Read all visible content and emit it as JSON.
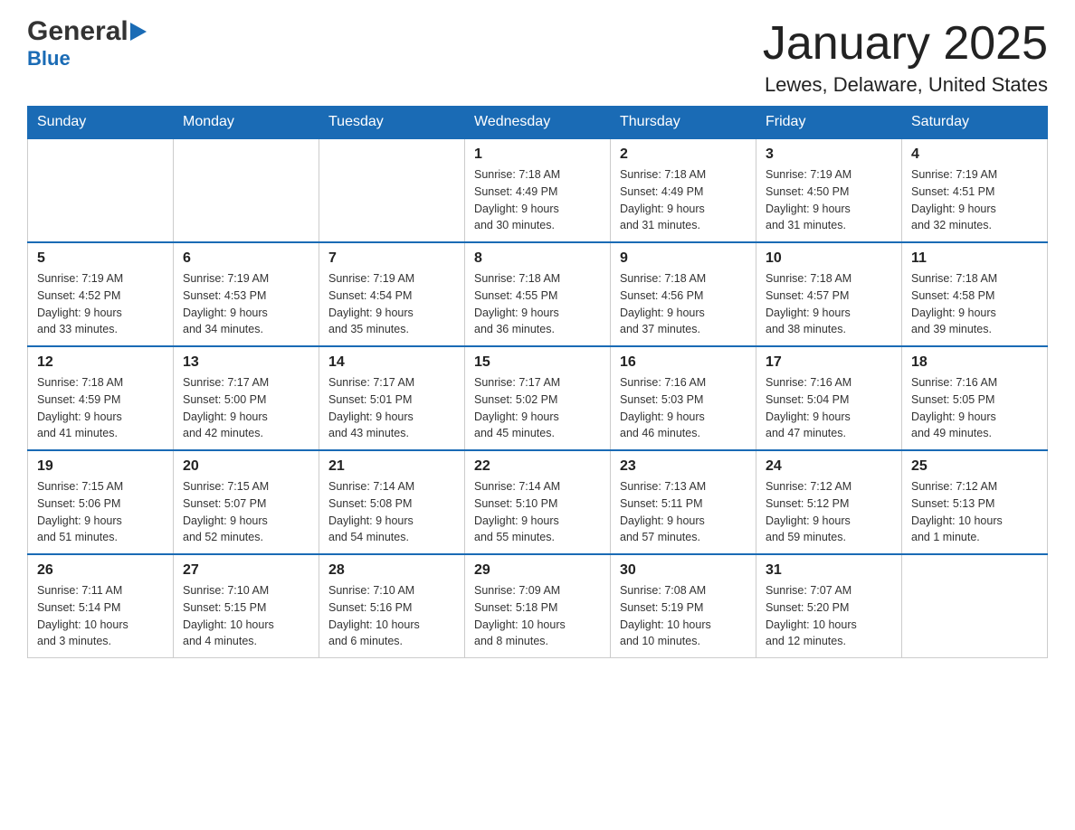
{
  "header": {
    "logo_general": "General",
    "logo_blue": "Blue",
    "title": "January 2025",
    "subtitle": "Lewes, Delaware, United States"
  },
  "calendar": {
    "days_of_week": [
      "Sunday",
      "Monday",
      "Tuesday",
      "Wednesday",
      "Thursday",
      "Friday",
      "Saturday"
    ],
    "weeks": [
      [
        {
          "day": "",
          "info": ""
        },
        {
          "day": "",
          "info": ""
        },
        {
          "day": "",
          "info": ""
        },
        {
          "day": "1",
          "info": "Sunrise: 7:18 AM\nSunset: 4:49 PM\nDaylight: 9 hours\nand 30 minutes."
        },
        {
          "day": "2",
          "info": "Sunrise: 7:18 AM\nSunset: 4:49 PM\nDaylight: 9 hours\nand 31 minutes."
        },
        {
          "day": "3",
          "info": "Sunrise: 7:19 AM\nSunset: 4:50 PM\nDaylight: 9 hours\nand 31 minutes."
        },
        {
          "day": "4",
          "info": "Sunrise: 7:19 AM\nSunset: 4:51 PM\nDaylight: 9 hours\nand 32 minutes."
        }
      ],
      [
        {
          "day": "5",
          "info": "Sunrise: 7:19 AM\nSunset: 4:52 PM\nDaylight: 9 hours\nand 33 minutes."
        },
        {
          "day": "6",
          "info": "Sunrise: 7:19 AM\nSunset: 4:53 PM\nDaylight: 9 hours\nand 34 minutes."
        },
        {
          "day": "7",
          "info": "Sunrise: 7:19 AM\nSunset: 4:54 PM\nDaylight: 9 hours\nand 35 minutes."
        },
        {
          "day": "8",
          "info": "Sunrise: 7:18 AM\nSunset: 4:55 PM\nDaylight: 9 hours\nand 36 minutes."
        },
        {
          "day": "9",
          "info": "Sunrise: 7:18 AM\nSunset: 4:56 PM\nDaylight: 9 hours\nand 37 minutes."
        },
        {
          "day": "10",
          "info": "Sunrise: 7:18 AM\nSunset: 4:57 PM\nDaylight: 9 hours\nand 38 minutes."
        },
        {
          "day": "11",
          "info": "Sunrise: 7:18 AM\nSunset: 4:58 PM\nDaylight: 9 hours\nand 39 minutes."
        }
      ],
      [
        {
          "day": "12",
          "info": "Sunrise: 7:18 AM\nSunset: 4:59 PM\nDaylight: 9 hours\nand 41 minutes."
        },
        {
          "day": "13",
          "info": "Sunrise: 7:17 AM\nSunset: 5:00 PM\nDaylight: 9 hours\nand 42 minutes."
        },
        {
          "day": "14",
          "info": "Sunrise: 7:17 AM\nSunset: 5:01 PM\nDaylight: 9 hours\nand 43 minutes."
        },
        {
          "day": "15",
          "info": "Sunrise: 7:17 AM\nSunset: 5:02 PM\nDaylight: 9 hours\nand 45 minutes."
        },
        {
          "day": "16",
          "info": "Sunrise: 7:16 AM\nSunset: 5:03 PM\nDaylight: 9 hours\nand 46 minutes."
        },
        {
          "day": "17",
          "info": "Sunrise: 7:16 AM\nSunset: 5:04 PM\nDaylight: 9 hours\nand 47 minutes."
        },
        {
          "day": "18",
          "info": "Sunrise: 7:16 AM\nSunset: 5:05 PM\nDaylight: 9 hours\nand 49 minutes."
        }
      ],
      [
        {
          "day": "19",
          "info": "Sunrise: 7:15 AM\nSunset: 5:06 PM\nDaylight: 9 hours\nand 51 minutes."
        },
        {
          "day": "20",
          "info": "Sunrise: 7:15 AM\nSunset: 5:07 PM\nDaylight: 9 hours\nand 52 minutes."
        },
        {
          "day": "21",
          "info": "Sunrise: 7:14 AM\nSunset: 5:08 PM\nDaylight: 9 hours\nand 54 minutes."
        },
        {
          "day": "22",
          "info": "Sunrise: 7:14 AM\nSunset: 5:10 PM\nDaylight: 9 hours\nand 55 minutes."
        },
        {
          "day": "23",
          "info": "Sunrise: 7:13 AM\nSunset: 5:11 PM\nDaylight: 9 hours\nand 57 minutes."
        },
        {
          "day": "24",
          "info": "Sunrise: 7:12 AM\nSunset: 5:12 PM\nDaylight: 9 hours\nand 59 minutes."
        },
        {
          "day": "25",
          "info": "Sunrise: 7:12 AM\nSunset: 5:13 PM\nDaylight: 10 hours\nand 1 minute."
        }
      ],
      [
        {
          "day": "26",
          "info": "Sunrise: 7:11 AM\nSunset: 5:14 PM\nDaylight: 10 hours\nand 3 minutes."
        },
        {
          "day": "27",
          "info": "Sunrise: 7:10 AM\nSunset: 5:15 PM\nDaylight: 10 hours\nand 4 minutes."
        },
        {
          "day": "28",
          "info": "Sunrise: 7:10 AM\nSunset: 5:16 PM\nDaylight: 10 hours\nand 6 minutes."
        },
        {
          "day": "29",
          "info": "Sunrise: 7:09 AM\nSunset: 5:18 PM\nDaylight: 10 hours\nand 8 minutes."
        },
        {
          "day": "30",
          "info": "Sunrise: 7:08 AM\nSunset: 5:19 PM\nDaylight: 10 hours\nand 10 minutes."
        },
        {
          "day": "31",
          "info": "Sunrise: 7:07 AM\nSunset: 5:20 PM\nDaylight: 10 hours\nand 12 minutes."
        },
        {
          "day": "",
          "info": ""
        }
      ]
    ]
  }
}
